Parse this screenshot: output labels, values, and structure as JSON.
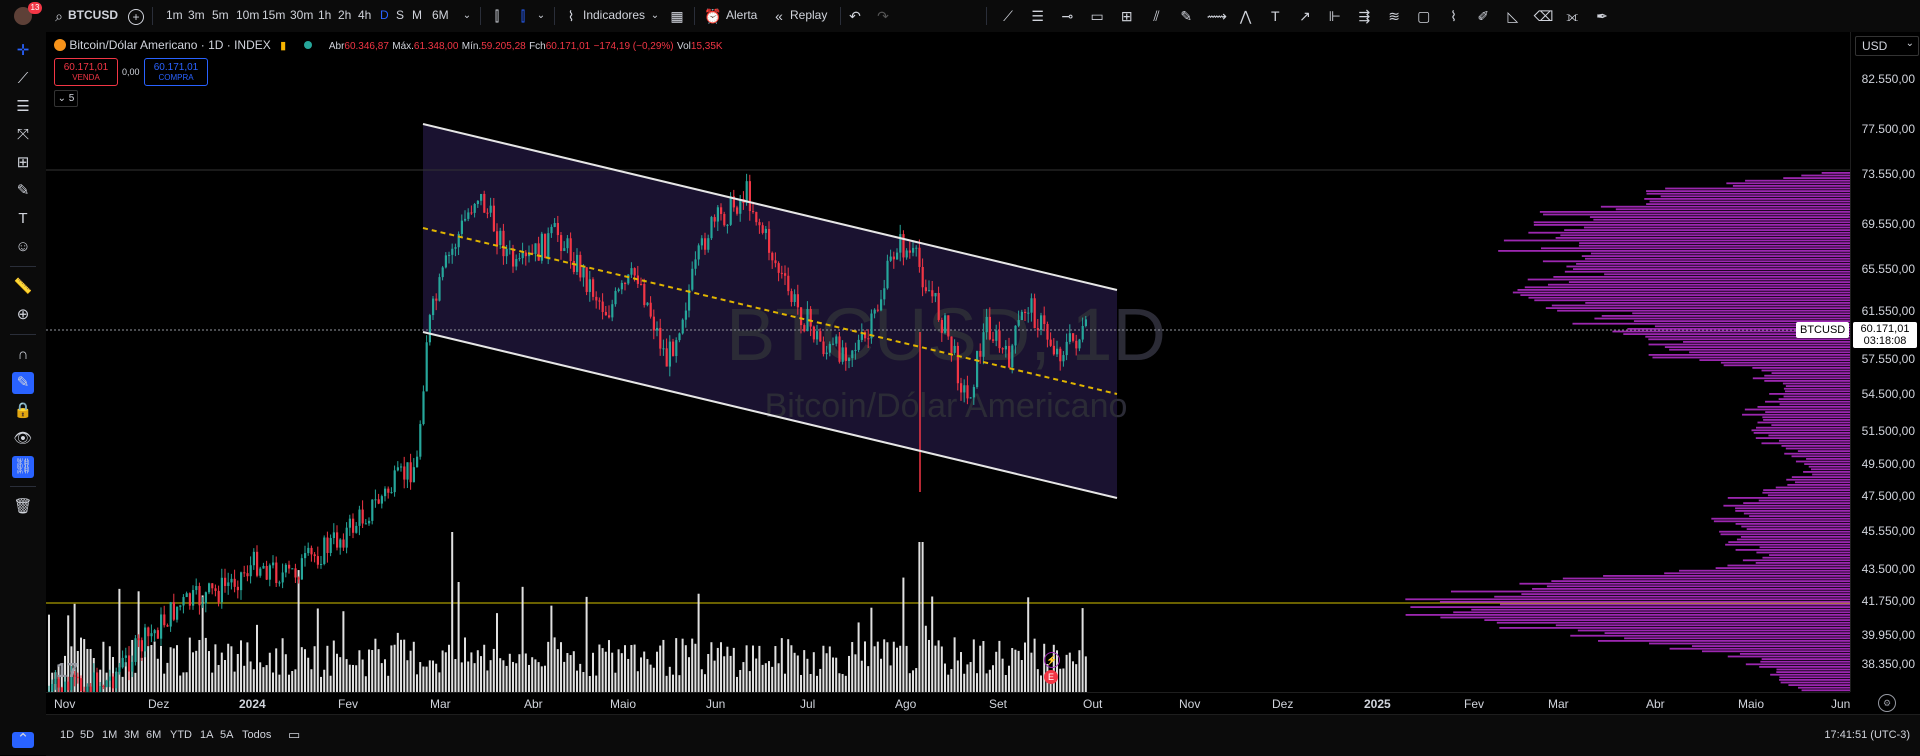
{
  "topbar": {
    "notification_count": "13",
    "symbol": "BTCUSD",
    "intervals": [
      "1m",
      "3m",
      "5m",
      "10m",
      "15m",
      "30m",
      "1h",
      "2h",
      "4h",
      "D",
      "S",
      "M",
      "6M"
    ],
    "active_interval": "D",
    "indicators_label": "Indicadores",
    "alert_label": "Alerta",
    "replay_label": "Replay"
  },
  "legend": {
    "title": "Bitcoin/Dólar Americano · 1D · INDEX",
    "open_key": "Abr",
    "open_val": "60.346,87",
    "high_key": "Máx.",
    "high_val": "61.348,00",
    "low_key": "Mín.",
    "low_val": "59.205,28",
    "close_key": "Fch",
    "close_val": "60.171,01",
    "change_val": "−174,19 (−0,29%)",
    "vol_key": "Vol",
    "vol_val": "15,35K",
    "sell_price": "60.171,01",
    "sell_label": "VENDA",
    "spread": "0,00",
    "buy_price": "60.171,01",
    "buy_label": "COMPRA",
    "indicators_count": "5"
  },
  "watermark": {
    "symbol": "BTCUSD, 1D",
    "name": "Bitcoin/Dólar Americano"
  },
  "price_axis": {
    "currency": "USD",
    "labels": [
      "82.550,00",
      "77.500,00",
      "73.550,00",
      "69.550,00",
      "65.550,00",
      "61.550,00",
      "57.550,00",
      "54.500,00",
      "51.500,00",
      "49.500,00",
      "47.500,00",
      "45.550,00",
      "43.500,00",
      "41.750,00",
      "39.950,00",
      "38.350,00"
    ],
    "current_symbol": "BTCUSD",
    "current_price": "60.171,01",
    "countdown": "03:18:08"
  },
  "time_axis": {
    "labels": [
      "Nov",
      "Dez",
      "2024",
      "Fev",
      "Mar",
      "Abr",
      "Maio",
      "Jun",
      "Jul",
      "Ago",
      "Set",
      "Out",
      "Nov",
      "Dez",
      "2025",
      "Fev",
      "Mar",
      "Abr",
      "Maio",
      "Jun"
    ]
  },
  "bottombar": {
    "ranges": [
      "1D",
      "5D",
      "1M",
      "3M",
      "6M",
      "YTD",
      "1A",
      "5A",
      "Todos"
    ],
    "clock": "17:41:51 (UTC-3)"
  },
  "colors": {
    "up": "#26a69a",
    "down": "#f23645",
    "channel_fill": "#1a1230",
    "profile": "#9c27b0",
    "midline": "#e0b400",
    "hline": "#d4c200"
  }
}
